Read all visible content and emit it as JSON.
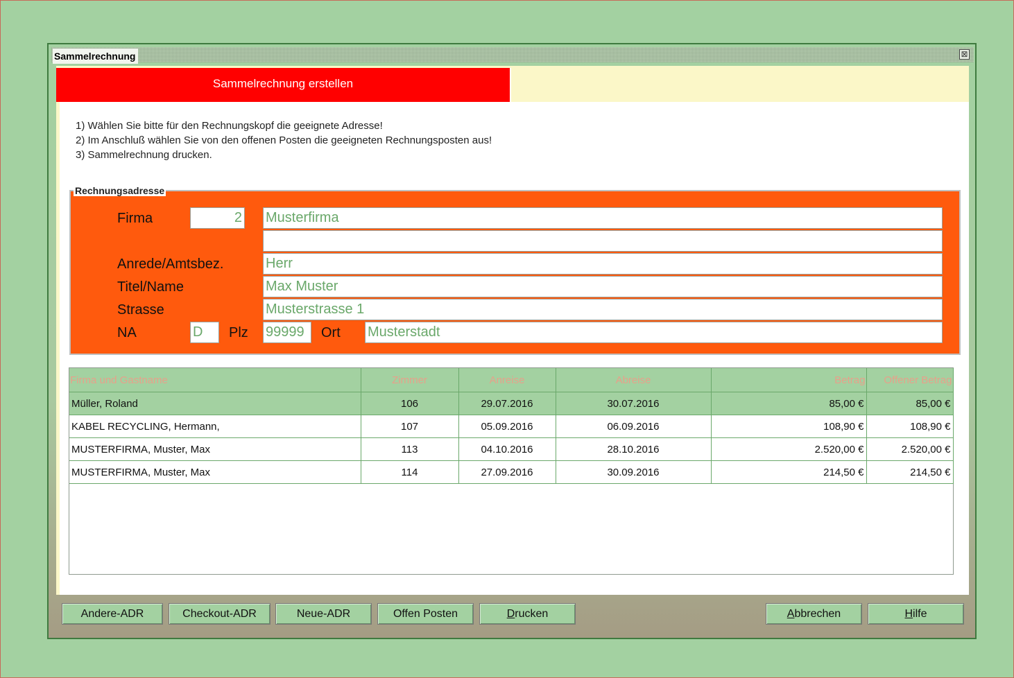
{
  "window": {
    "title": "Sammelrechnung",
    "close_symbol": "⊠"
  },
  "header": {
    "banner": "Sammelrechnung erstellen"
  },
  "instructions": [
    "1) Wählen Sie bitte für den Rechnungskopf die geeignete Adresse!",
    "2) Im Anschluß wählen Sie von den offenen Posten die geeigneten Rechnungsposten aus!",
    "3) Sammelrechnung drucken."
  ],
  "address": {
    "legend": "Rechnungsadresse",
    "labels": {
      "firma": "Firma",
      "anrede": "Anrede/Amtsbez.",
      "titel_name": "Titel/Name",
      "strasse": "Strasse",
      "na": "NA",
      "plz": "Plz",
      "ort": "Ort"
    },
    "values": {
      "firma_nr": "2",
      "firma": "Musterfirma",
      "firma2": "",
      "anrede": "Herr",
      "name": "Max Muster",
      "strasse": "Musterstrasse 1",
      "na": "D",
      "plz": "99999",
      "ort": "Musterstadt"
    }
  },
  "table": {
    "columns": [
      "Firma und Gastname",
      "Zimmer",
      "Anreise",
      "Abreise",
      "Betrag",
      "Offener Betrag"
    ],
    "rows": [
      [
        "Müller, Roland",
        "106",
        "29.07.2016",
        "30.07.2016",
        "85,00 €",
        "85,00 €"
      ],
      [
        "KABEL RECYCLING, Hermann,",
        "107",
        "05.09.2016",
        "06.09.2016",
        "108,90 €",
        "108,90 €"
      ],
      [
        "MUSTERFIRMA, Muster, Max",
        "113",
        "04.10.2016",
        "28.10.2016",
        "2.520,00 €",
        "2.520,00 €"
      ],
      [
        "MUSTERFIRMA, Muster, Max",
        "114",
        "27.09.2016",
        "30.09.2016",
        "214,50 €",
        "214,50 €"
      ]
    ],
    "selected_row": 0
  },
  "buttons": {
    "andere_adr": "Andere-ADR",
    "checkout_adr": "Checkout-ADR",
    "neue_adr": "Neue-ADR",
    "offen_posten": "Offen Posten",
    "drucken_first": "D",
    "drucken_rest": "rucken",
    "abbrechen_first": "A",
    "abbrechen_rest": "bbrechen",
    "hilfe_first": "H",
    "hilfe_rest": "ilfe"
  },
  "colors": {
    "background": "#a3d1a1",
    "banner_red": "#ff0000",
    "address_orange": "#ff5a0d",
    "header_yellow": "#fbf7c8",
    "field_text_green": "#6aa86a"
  }
}
